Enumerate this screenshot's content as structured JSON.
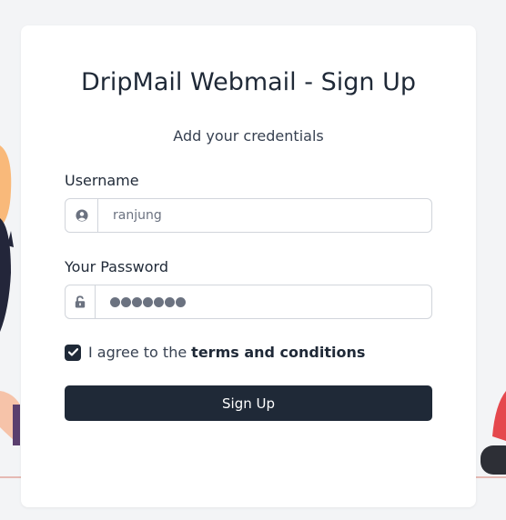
{
  "page": {
    "title": "DripMail Webmail - Sign Up",
    "subtitle": "Add your credentials"
  },
  "form": {
    "username_label": "Username",
    "username_value": "ranjung",
    "username_icon": "user-circle-icon",
    "password_label": "Your Password",
    "password_length": 7,
    "password_icon": "unlock-icon",
    "agree_prefix": "I agree to the",
    "agree_link": "terms and conditions",
    "agree_checked": true,
    "submit_label": "Sign Up"
  },
  "colors": {
    "primary": "#1f2937",
    "background": "#f3f4f6",
    "card": "#ffffff"
  }
}
